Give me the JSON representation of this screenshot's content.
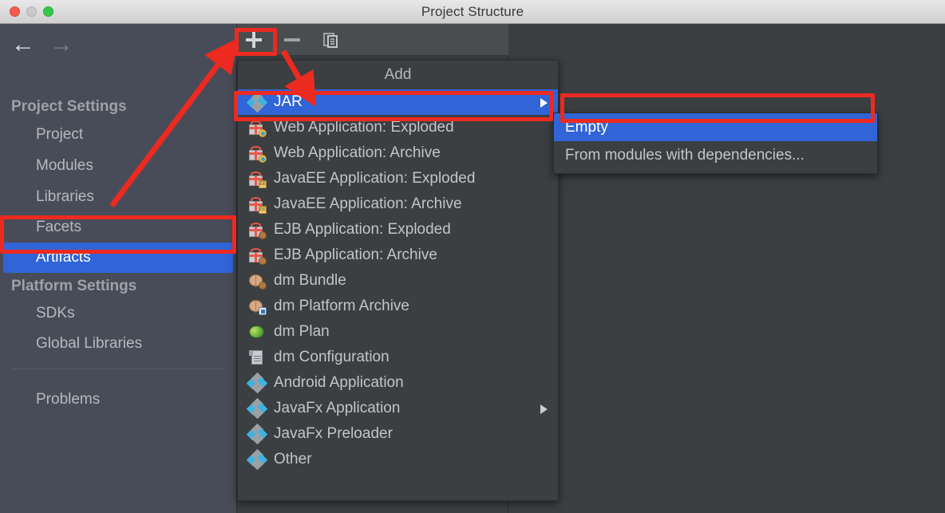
{
  "window": {
    "title": "Project Structure",
    "traffic_lights": [
      "close-button",
      "minimize-button",
      "maximize-button"
    ]
  },
  "sidebar": {
    "back_icon": "←",
    "forward_icon": "→",
    "groups": [
      {
        "heading": "Project Settings",
        "items": [
          {
            "label": "Project",
            "selected": false
          },
          {
            "label": "Modules",
            "selected": false
          },
          {
            "label": "Libraries",
            "selected": false
          },
          {
            "label": "Facets",
            "selected": false
          },
          {
            "label": "Artifacts",
            "selected": true
          }
        ]
      },
      {
        "heading": "Platform Settings",
        "items": [
          {
            "label": "SDKs",
            "selected": false
          },
          {
            "label": "Global Libraries",
            "selected": false
          }
        ]
      }
    ],
    "problems": "Problems"
  },
  "toolbar": {
    "add_label": "+",
    "remove_label": "−",
    "copy_label": "copy",
    "buttons": [
      {
        "name": "add-artifact-button",
        "icon": "plus-icon"
      },
      {
        "name": "remove-artifact-button",
        "icon": "minus-icon"
      },
      {
        "name": "copy-artifact-button",
        "icon": "copy-icon"
      }
    ]
  },
  "menu": {
    "title": "Add",
    "items": [
      {
        "label": "JAR",
        "icon": "jar-icon",
        "selected": true,
        "submenu": true
      },
      {
        "label": "Web Application: Exploded",
        "icon": "gift-globe-icon",
        "selected": false,
        "submenu": false
      },
      {
        "label": "Web Application: Archive",
        "icon": "gift-globe-icon",
        "selected": false,
        "submenu": false
      },
      {
        "label": "JavaEE Application: Exploded",
        "icon": "gift-ee-icon",
        "selected": false,
        "submenu": false
      },
      {
        "label": "JavaEE Application: Archive",
        "icon": "gift-ee-icon",
        "selected": false,
        "submenu": false
      },
      {
        "label": "EJB Application: Exploded",
        "icon": "gift-bean-icon",
        "selected": false,
        "submenu": false
      },
      {
        "label": "EJB Application: Archive",
        "icon": "gift-bean-icon",
        "selected": false,
        "submenu": false
      },
      {
        "label": "dm Bundle",
        "icon": "dm-bundle-icon",
        "selected": false,
        "submenu": false
      },
      {
        "label": "dm Platform Archive",
        "icon": "dm-archive-icon",
        "selected": false,
        "submenu": false
      },
      {
        "label": "dm Plan",
        "icon": "dm-plan-icon",
        "selected": false,
        "submenu": false
      },
      {
        "label": "dm Configuration",
        "icon": "dm-configuration-icon",
        "selected": false,
        "submenu": false
      },
      {
        "label": "Android Application",
        "icon": "jar-icon",
        "selected": false,
        "submenu": false
      },
      {
        "label": "JavaFx Application",
        "icon": "jar-icon",
        "selected": false,
        "submenu": true
      },
      {
        "label": "JavaFx Preloader",
        "icon": "jar-icon",
        "selected": false,
        "submenu": false
      },
      {
        "label": "Other",
        "icon": "jar-icon",
        "selected": false,
        "submenu": false
      }
    ]
  },
  "submenu": {
    "items": [
      {
        "label": "Empty",
        "selected": true
      },
      {
        "label": "From modules with dependencies...",
        "selected": false
      }
    ]
  },
  "annotations": {
    "color": "#ec2a20",
    "highlight_boxes": [
      "add-button",
      "artifacts-sidebar-item",
      "jar-menu-item",
      "empty-submenu-item"
    ],
    "arrows": [
      "artifacts-to-add-arrow",
      "add-to-jar-arrow"
    ]
  }
}
